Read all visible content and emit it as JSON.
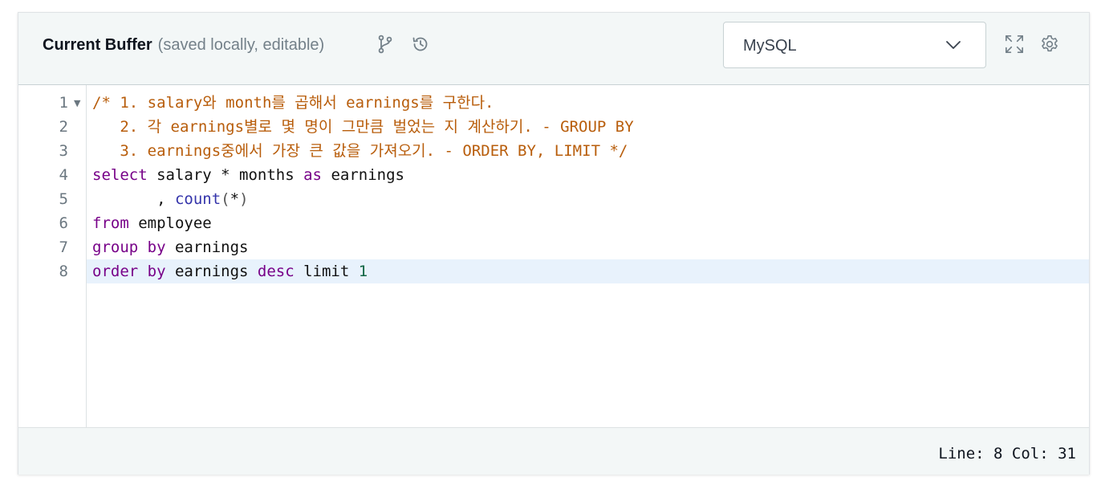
{
  "header": {
    "title": "Current Buffer",
    "subtitle": "(saved locally, editable)",
    "icons": [
      "branch-icon",
      "history-icon",
      "fullscreen-icon",
      "gear-icon"
    ]
  },
  "language_select": {
    "selected": "MySQL"
  },
  "editor": {
    "lines": [
      {
        "number": "1",
        "tokens": [
          {
            "t": "/* 1. salary와 month를 곱해서 earnings를 구한다.",
            "c": "comment"
          }
        ]
      },
      {
        "number": "2",
        "tokens": [
          {
            "t": "   2. 각 earnings별로 몇 명이 그만큼 벌었는 지 계산하기. - GROUP BY",
            "c": "comment"
          }
        ]
      },
      {
        "number": "3",
        "tokens": [
          {
            "t": "   3. earnings중에서 가장 큰 값을 가져오기. - ORDER BY, LIMIT */",
            "c": "comment"
          }
        ]
      },
      {
        "number": "4",
        "tokens": [
          {
            "t": "select",
            "c": "kw"
          },
          {
            "t": " salary * months ",
            "c": "plain"
          },
          {
            "t": "as",
            "c": "kw"
          },
          {
            "t": " earnings",
            "c": "plain"
          }
        ]
      },
      {
        "number": "5",
        "tokens": [
          {
            "t": "       , ",
            "c": "plain"
          },
          {
            "t": "count",
            "c": "fn"
          },
          {
            "t": "(",
            "c": "punc"
          },
          {
            "t": "*",
            "c": "plain"
          },
          {
            "t": ")",
            "c": "punc"
          }
        ]
      },
      {
        "number": "6",
        "tokens": [
          {
            "t": "from",
            "c": "kw"
          },
          {
            "t": " employee",
            "c": "plain"
          }
        ]
      },
      {
        "number": "7",
        "tokens": [
          {
            "t": "group by",
            "c": "kw"
          },
          {
            "t": " earnings",
            "c": "plain"
          }
        ]
      },
      {
        "number": "8",
        "tokens": [
          {
            "t": "order by",
            "c": "kw"
          },
          {
            "t": " earnings ",
            "c": "plain"
          },
          {
            "t": "desc",
            "c": "kw"
          },
          {
            "t": " limit ",
            "c": "plain"
          },
          {
            "t": "1",
            "c": "num"
          }
        ]
      }
    ],
    "active_line": 8
  },
  "footer": {
    "status": "Line: 8 Col: 31"
  }
}
